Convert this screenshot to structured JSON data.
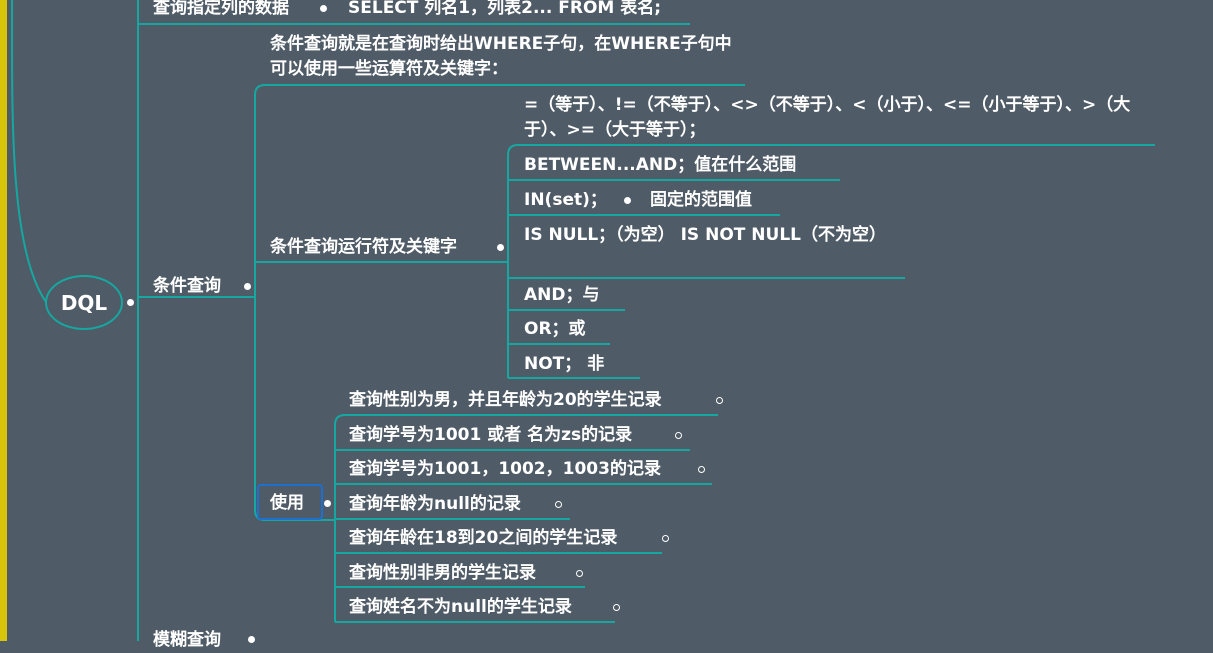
{
  "root": {
    "label": "DQL"
  },
  "top_item": {
    "label": "查询指定列的数据",
    "child": "SELECT 列名1，列表2... FROM 表名;"
  },
  "condition": {
    "label": "条件查询",
    "description": "条件查询就是在查询时给出WHERE子句，在WHERE子句中可以使用一些运算符及关键字：",
    "operators": {
      "label": "条件查询运行符及关键字",
      "items": [
        "=（等于）、!=（不等于）、<>（不等于）、<（小于）、<=（小于等于）、>（大于）、>=（大于等于）；",
        "BETWEEN...AND；值在什么范围",
        "IN(set)；",
        "IS NULL；（为空） IS NOT NULL（不为空）",
        "AND；与",
        "OR；或",
        "NOT； 非"
      ],
      "in_set_child": "固定的范围值"
    },
    "usage": {
      "label": "使用",
      "items": [
        "查询性别为男，并且年龄为20的学生记录",
        "查询学号为1001 或者 名为zs的记录",
        "查询学号为1001，1002，1003的记录",
        "查询年龄为null的记录",
        "查询年龄在18到20之间的学生记录",
        "查询性别非男的学生记录",
        "查询姓名不为null的学生记录"
      ]
    }
  },
  "bottom_item": {
    "label": "模糊查询"
  },
  "colors": {
    "background": "#4f5b66",
    "line": "#16a7a1",
    "selection": "#1e6fd0",
    "strip": "#d8c40a",
    "text": "#ffffff"
  }
}
